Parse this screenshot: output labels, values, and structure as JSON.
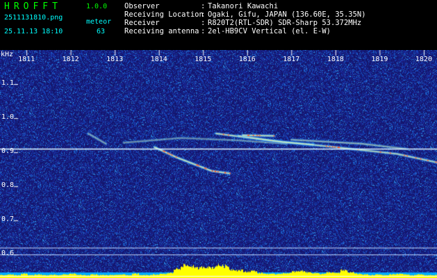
{
  "header": {
    "app_name": "HROFFT",
    "version": "1.0.0",
    "file_name": "2511131810.png",
    "mode": "meteor",
    "datetime": "25.11.13 18:10",
    "count": "63",
    "info_rows": [
      {
        "key": "Observer",
        "sep": ":",
        "value": "Takanori Kawachi"
      },
      {
        "key": "Receiving Location",
        "sep": ":",
        "value": "Ogaki, Gifu, JAPAN (136.60E, 35.35N)"
      },
      {
        "key": "Receiver",
        "sep": ":",
        "value": "R820T2(RTL-SDR) SDR-Sharp 53.372MHz"
      },
      {
        "key": "Receiving antenna",
        "sep": ":",
        "value": "2el-HB9CV Vertical (el. E-W)"
      }
    ]
  },
  "colors": {
    "app_name": "#00ff00",
    "version": "#00ff00",
    "file_name": "#00ffff",
    "mode": "#00ffff",
    "datetime": "#00ffff",
    "count": "#00ffff",
    "info": "#ffffff",
    "background": "#1a1a80",
    "carrier": "#d8f0ff",
    "axis_text": "#ffffff",
    "baseline": "#ffff00",
    "level_fill": "#00aaff"
  },
  "chart_data": {
    "type": "heatmap",
    "ylabel": "kHz",
    "x_ticks": [
      "1811",
      "1812",
      "1813",
      "1814",
      "1815",
      "1816",
      "1817",
      "1818",
      "1819",
      "1820"
    ],
    "y_ticks": [
      "1.1",
      "1.0",
      "0.9",
      "0.8",
      "0.7",
      "0.6"
    ],
    "x_range": [
      1810.4,
      1820.3
    ],
    "y_range": [
      0.58,
      1.2
    ],
    "carrier_khz": 0.91,
    "meteor_traces": [
      {
        "points": [
          [
            1812.4,
            0.955
          ],
          [
            1812.8,
            0.925
          ]
        ],
        "intensity": 0.55
      },
      {
        "points": [
          [
            1813.9,
            0.915
          ],
          [
            1814.4,
            0.885
          ],
          [
            1815.2,
            0.845
          ],
          [
            1815.6,
            0.838
          ]
        ],
        "intensity": 0.95
      },
      {
        "points": [
          [
            1813.2,
            0.928
          ],
          [
            1814.5,
            0.942
          ],
          [
            1815.8,
            0.935
          ],
          [
            1816.9,
            0.925
          ]
        ],
        "intensity": 0.45
      },
      {
        "points": [
          [
            1815.3,
            0.955
          ],
          [
            1816.5,
            0.935
          ],
          [
            1818.0,
            0.915
          ],
          [
            1819.4,
            0.895
          ],
          [
            1820.3,
            0.87
          ]
        ],
        "intensity": 0.85
      },
      {
        "points": [
          [
            1815.8,
            0.948
          ],
          [
            1816.8,
            0.93
          ],
          [
            1817.5,
            0.922
          ]
        ],
        "intensity": 0.8
      },
      {
        "points": [
          [
            1817.0,
            0.937
          ],
          [
            1818.6,
            0.925
          ],
          [
            1819.6,
            0.91
          ]
        ],
        "intensity": 0.6
      },
      {
        "points": [
          [
            1815.9,
            0.95
          ],
          [
            1816.6,
            0.948
          ]
        ],
        "intensity": 0.9
      }
    ],
    "level_series": [
      0.2,
      0.25,
      0.2,
      0.3,
      0.2,
      0.25,
      0.2,
      0.22,
      0.2,
      0.25,
      0.3,
      0.22,
      0.2,
      0.25,
      0.2,
      0.2,
      0.22,
      0.25,
      0.2,
      0.3,
      0.2,
      0.2,
      0.25,
      0.28,
      0.35,
      0.65,
      0.9,
      0.85,
      0.7,
      0.8,
      0.75,
      0.9,
      0.85,
      0.6,
      0.55,
      0.45,
      0.5,
      0.35,
      0.3,
      0.28,
      0.32,
      0.35,
      0.45,
      0.5,
      0.4,
      0.35,
      0.3,
      0.4,
      0.35,
      0.55,
      0.4,
      0.3,
      0.25,
      0.2,
      0.25,
      0.2,
      0.25,
      0.3,
      0.25,
      0.2,
      0.25,
      0.2,
      0.2
    ]
  }
}
